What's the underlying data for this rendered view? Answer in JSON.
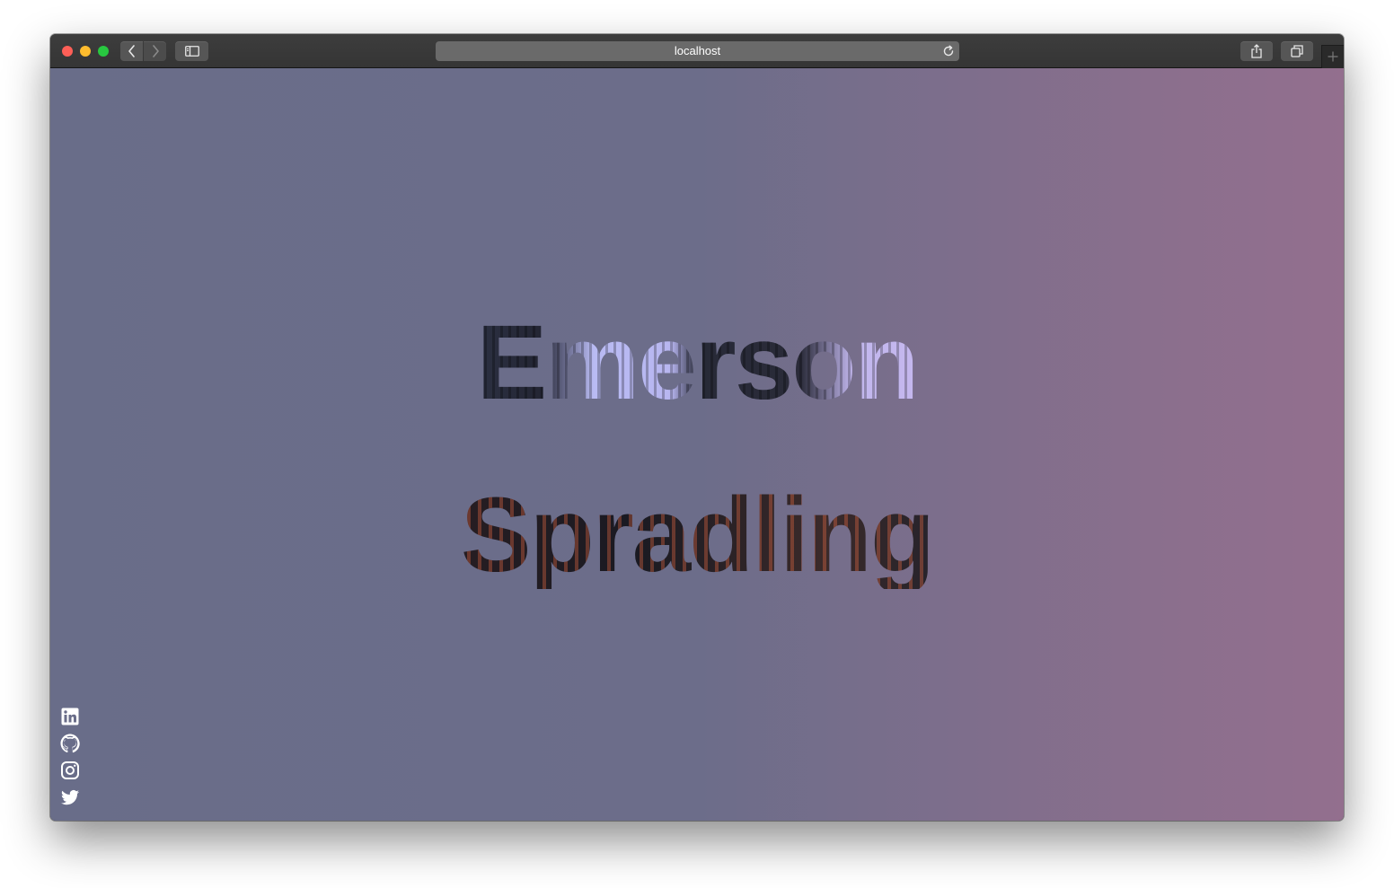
{
  "browser": {
    "url": "localhost"
  },
  "hero": {
    "first_name": "Emerson",
    "last_name": "Spradling"
  },
  "social": [
    {
      "icon": "linkedin-icon"
    },
    {
      "icon": "github-icon"
    },
    {
      "icon": "instagram-icon"
    },
    {
      "icon": "twitter-icon"
    }
  ],
  "colors": {
    "background_left": "#696d89",
    "background_right": "#936f8e",
    "chrome": "#3a3a3a",
    "url_bar": "#6a6a6a"
  }
}
